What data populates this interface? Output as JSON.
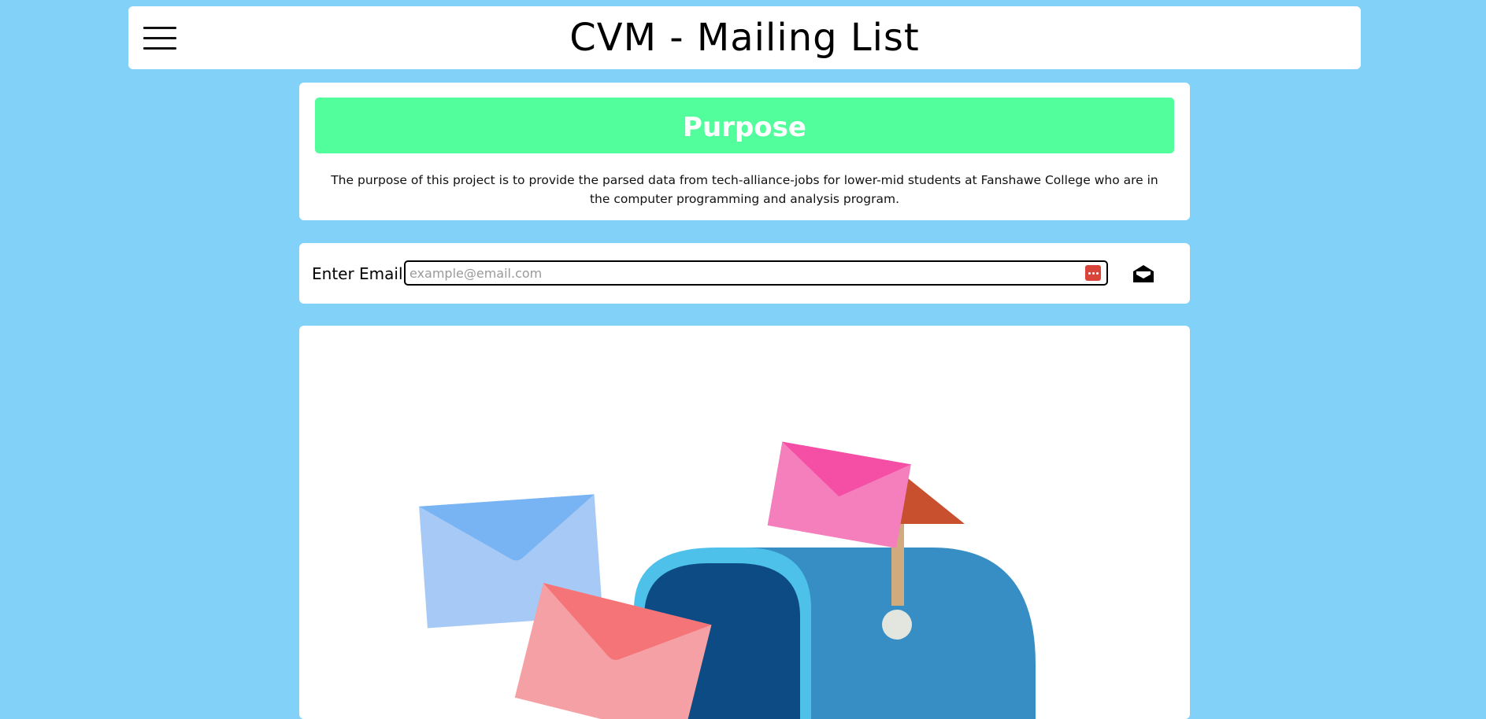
{
  "header": {
    "title": "CVM - Mailing List",
    "menu_icon": "hamburger-menu-icon"
  },
  "purpose": {
    "heading": "Purpose",
    "text": "The purpose of this project is to provide the parsed data from tech-alliance-jobs for lower-mid students at Fanshawe College who are in the computer programming and analysis program."
  },
  "email_form": {
    "label": "Enter Email",
    "value": "",
    "placeholder": "example@email.com",
    "send_icon": "envelope-open-icon",
    "password_manager_icon": "password-manager-icon"
  },
  "illustration": {
    "name": "mailbox-with-envelopes",
    "colors": {
      "page_background": "#81d1f9",
      "banner": "#52fd9b",
      "mailbox_body": "#368ec4",
      "mailbox_door": "#0c4b83",
      "mailbox_rim": "#4dc1ea",
      "flag": "#c9502e",
      "flag_pole": "#d1aa7e"
    }
  }
}
